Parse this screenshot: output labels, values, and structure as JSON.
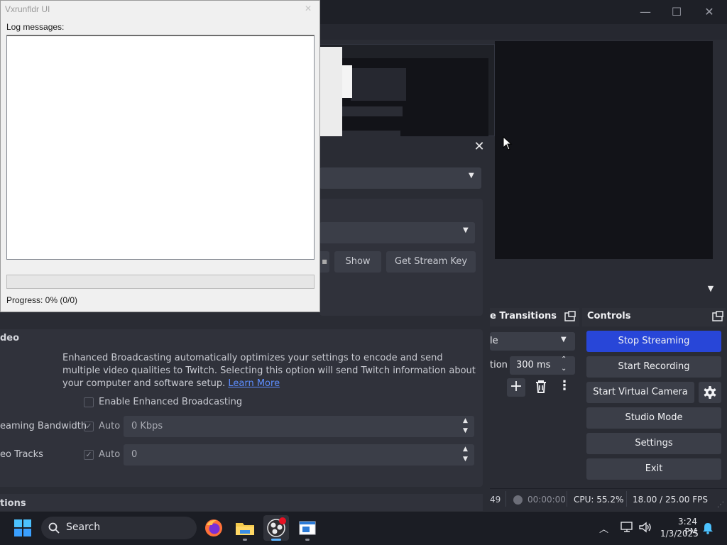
{
  "obs": {
    "window_controls": {
      "minimize": "—",
      "maximize": "☐",
      "close": "✕"
    },
    "transitions": {
      "title": "Scene Transitions",
      "title_visible": "e Transitions",
      "selected_visible": "le",
      "duration_label_visible": "tion",
      "duration_value": "300 ms"
    },
    "controls": {
      "title": "Controls",
      "stop_streaming": "Stop Streaming",
      "start_recording": "Start Recording",
      "start_virtual_camera": "Start Virtual Camera",
      "studio_mode": "Studio Mode",
      "settings": "Settings",
      "exit": "Exit"
    },
    "status": {
      "dropped_visible": "49",
      "rec_time": "00:00:00",
      "cpu": "CPU: 55.2%",
      "fps": "18.00 / 25.00 FPS"
    },
    "accent_color": "#2846d8"
  },
  "settings_dialog": {
    "close_glyph": "✕",
    "show_button": "Show",
    "get_stream_key_button": "Get Stream Key",
    "video_heading_visible": "deo",
    "enhanced_description": "Enhanced Broadcasting automatically optimizes your settings to encode and send multiple video qualities to Twitch. Selecting this option will send Twitch information about your computer and software setup.",
    "learn_more": "Learn More",
    "enable_enhanced": "Enable Enhanced Broadcasting",
    "bandwidth_label_visible": "eaming Bandwidth",
    "bandwidth_auto": "Auto",
    "bandwidth_value": "0 Kbps",
    "tracks_label_visible": "eo Tracks",
    "tracks_auto": "Auto",
    "tracks_value": "0",
    "options_heading_visible": "tions"
  },
  "vxrunfldr": {
    "title": "Vxrunfldr UI",
    "log_label": "Log messages:",
    "progress_text": "Progress: 0% (0/0)",
    "progress_fraction": 0,
    "progress_color": "#06b025"
  },
  "taskbar": {
    "search_label": "Search",
    "time": "3:24 PM",
    "date": "1/3/2025",
    "apps": [
      "firefox-icon",
      "file-explorer-icon",
      "obs-icon",
      "vxrunfldr-icon"
    ]
  }
}
